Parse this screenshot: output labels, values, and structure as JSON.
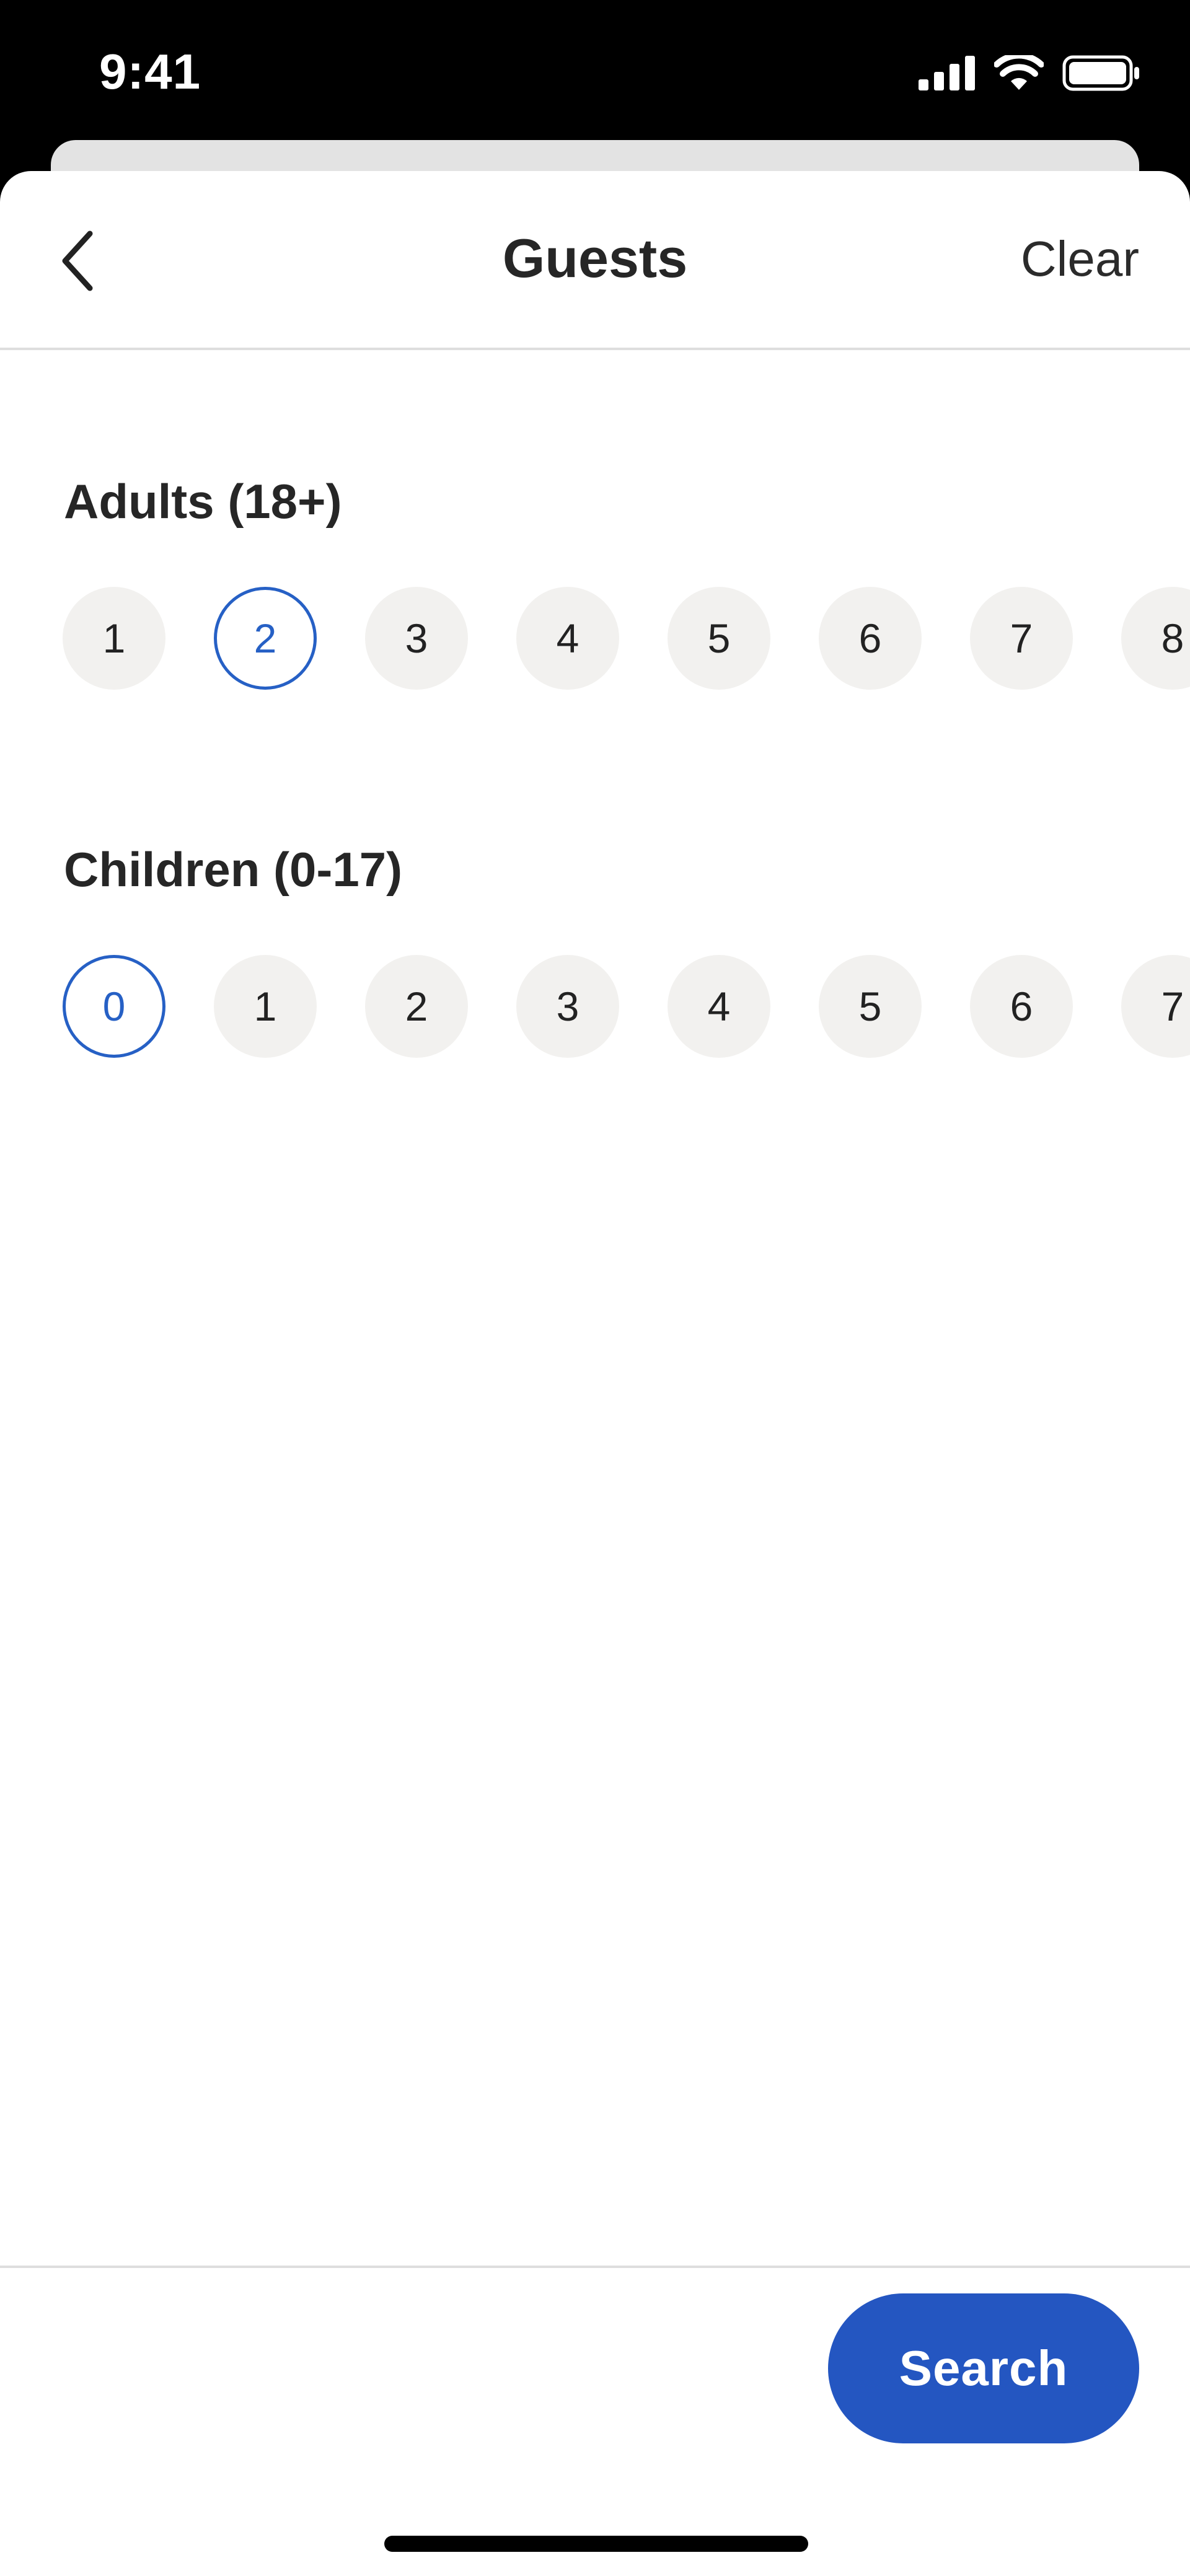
{
  "status_bar": {
    "time": "9:41"
  },
  "header": {
    "title": "Guests",
    "clear_label": "Clear"
  },
  "adults": {
    "label": "Adults (18+)",
    "options": [
      "1",
      "2",
      "3",
      "4",
      "5",
      "6",
      "7",
      "8"
    ],
    "selected": "2"
  },
  "children": {
    "label": "Children (0-17)",
    "options": [
      "0",
      "1",
      "2",
      "3",
      "4",
      "5",
      "6",
      "7"
    ],
    "selected": "0"
  },
  "footer": {
    "search_label": "Search"
  },
  "colors": {
    "accent": "#2660c5",
    "button": "#2456c1",
    "chip_bg": "#f2f1ef",
    "divider": "#dedede"
  }
}
